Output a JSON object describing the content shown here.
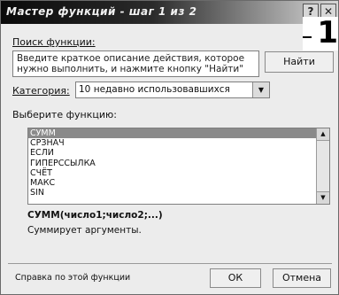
{
  "window": {
    "title": "Мастер функций - шаг 1 из 2",
    "help_glyph": "?",
    "close_glyph": "✕",
    "step_marker": "1"
  },
  "search": {
    "label": "Поиск функции:",
    "text": "Введите краткое описание действия, которое нужно выполнить, и нажмите кнопку \"Найти\"",
    "find_button": "Найти"
  },
  "category": {
    "label": "Категория:",
    "selected": "10 недавно использовавшихся"
  },
  "functions": {
    "label": "Выберите функцию:",
    "items": [
      "СУММ",
      "СРЗНАЧ",
      "ЕСЛИ",
      "ГИПЕРССЫЛКА",
      "СЧЁТ",
      "МАКС",
      "SIN"
    ],
    "selected_index": 0
  },
  "selected_function": {
    "syntax": "СУММ(число1;число2;...)",
    "description": "Суммирует аргументы."
  },
  "footer": {
    "help_link": "Справка по этой функции",
    "ok": "ОК",
    "cancel": "Отмена"
  }
}
